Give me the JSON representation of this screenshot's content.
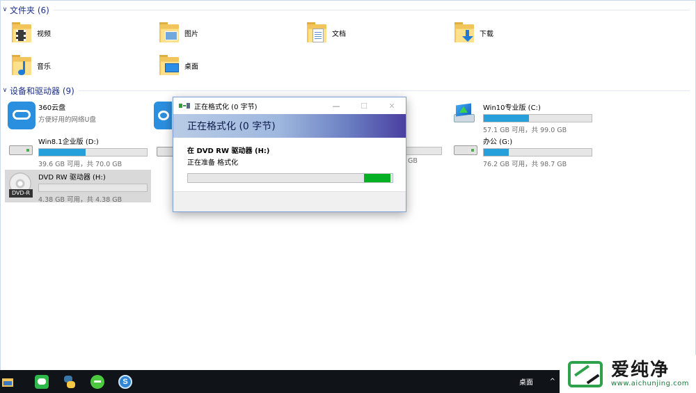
{
  "folders_group": {
    "title": "文件夹 (6)",
    "items": [
      {
        "label": "视频",
        "icon": "video-folder-icon"
      },
      {
        "label": "图片",
        "icon": "pictures-folder-icon"
      },
      {
        "label": "文档",
        "icon": "documents-folder-icon"
      },
      {
        "label": "下载",
        "icon": "downloads-folder-icon"
      },
      {
        "label": "音乐",
        "icon": "music-folder-icon"
      },
      {
        "label": "桌面",
        "icon": "desktop-folder-icon"
      }
    ]
  },
  "devices_group": {
    "title": "设备和驱动器 (9)",
    "items": [
      {
        "name": "360云盘",
        "sub": "方便好用的网络U盘",
        "icon": "cloud-drive-icon"
      },
      {
        "name": "Win10专业版 (C:)",
        "free": "57.1 GB 可用，共 99.0 GB",
        "used_fraction": 0.42,
        "icon": "system-drive-icon"
      },
      {
        "name": "Win8.1企业版 (D:)",
        "free": "39.6 GB 可用，共 70.0 GB",
        "used_fraction": 0.43,
        "icon": "hard-drive-icon"
      },
      {
        "name": "办公 (G:)",
        "free": "76.2 GB 可用，共 98.7 GB",
        "used_fraction": 0.23,
        "icon": "hard-drive-icon"
      },
      {
        "name": "DVD RW 驱动器 (H:)",
        "free": "4.38 GB 可用，共 4.38 GB",
        "used_fraction": 0.0,
        "icon": "dvd-drive-icon",
        "dvd_badge": "DVD-R"
      }
    ],
    "partial_free_label": "GB"
  },
  "dialog": {
    "title": "正在格式化 (0 字节)",
    "banner": "正在格式化 (0 字节)",
    "line1": "在 DVD RW 驱动器 (H:)",
    "line2": "正在准备 格式化",
    "progress_fraction": 0.13,
    "progress_start_fraction": 0.86
  },
  "taskbar": {
    "desktop_label": "桌面",
    "chevron": "^"
  },
  "watermark": {
    "brand": "爱纯净",
    "url": "www.aichunjing.com"
  },
  "colors": {
    "accent": "#26a0da",
    "header_text": "#1e3287",
    "progress_green": "#06b025",
    "taskbar": "#101419"
  }
}
